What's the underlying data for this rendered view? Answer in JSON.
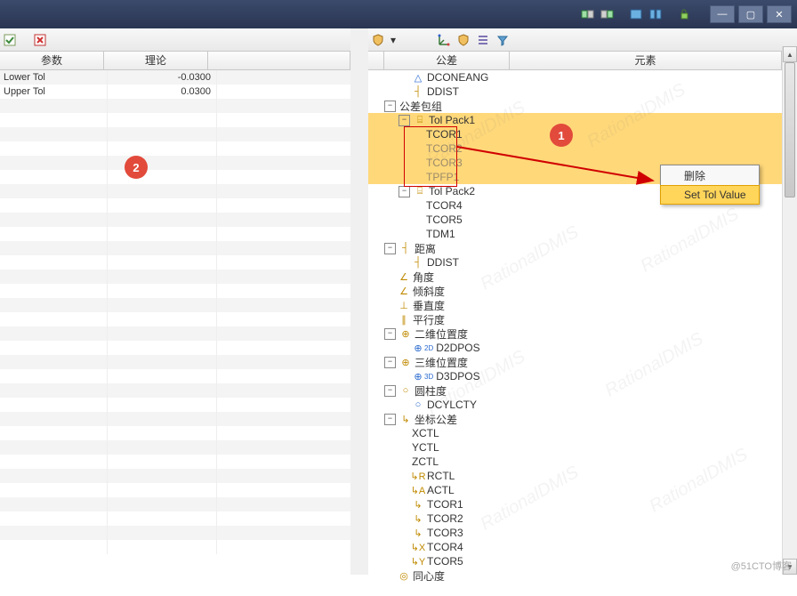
{
  "titlebar": {},
  "left": {
    "headers": {
      "param": "参数",
      "theory": "理论"
    },
    "rows": [
      {
        "param": "Lower Tol",
        "value": "-0.0300",
        "alt": true
      },
      {
        "param": "Upper Tol",
        "value": "0.0300",
        "alt": false
      }
    ],
    "badge": "2"
  },
  "right": {
    "headers": {
      "tol": "公差",
      "elem": "元素"
    },
    "badge": "1",
    "context": {
      "del": "删除",
      "set": "Set Tol Value"
    },
    "tree": [
      {
        "ind": 1,
        "exp": "",
        "icon": "△",
        "iconColor": "#2a6ad0",
        "label": "DCONEANG"
      },
      {
        "ind": 1,
        "exp": "",
        "icon": "┤",
        "iconColor": "#c08a00",
        "label": "DDIST"
      },
      {
        "ind": 0,
        "exp": "-",
        "icon": "",
        "iconColor": "",
        "label": "公差包组"
      },
      {
        "ind": 1,
        "exp": "-",
        "icon": "⌸",
        "iconColor": "#c08a00",
        "label": "Tol Pack1",
        "selrow": true
      },
      {
        "ind": 2,
        "exp": "",
        "icon": "",
        "iconColor": "",
        "label": "TCOR1",
        "sel": true,
        "rb": "top"
      },
      {
        "ind": 2,
        "exp": "",
        "icon": "",
        "iconColor": "",
        "label": "TCOR2",
        "sel": true,
        "gray": true
      },
      {
        "ind": 2,
        "exp": "",
        "icon": "",
        "iconColor": "",
        "label": "TCOR3",
        "sel": true,
        "gray": true
      },
      {
        "ind": 2,
        "exp": "",
        "icon": "",
        "iconColor": "",
        "label": "TPFP1",
        "sel": true,
        "gray": true,
        "rb": "bot"
      },
      {
        "ind": 1,
        "exp": "-",
        "icon": "⌸",
        "iconColor": "#c08a00",
        "label": "Tol Pack2"
      },
      {
        "ind": 2,
        "exp": "",
        "icon": "",
        "iconColor": "",
        "label": "TCOR4"
      },
      {
        "ind": 2,
        "exp": "",
        "icon": "",
        "iconColor": "",
        "label": "TCOR5"
      },
      {
        "ind": 2,
        "exp": "",
        "icon": "",
        "iconColor": "",
        "label": "TDM1"
      },
      {
        "ind": 0,
        "exp": "-",
        "icon": "┤",
        "iconColor": "#c08a00",
        "label": "距离"
      },
      {
        "ind": 1,
        "exp": "",
        "icon": "┤",
        "iconColor": "#c08a00",
        "label": "DDIST"
      },
      {
        "ind": 0,
        "exp": "",
        "icon": "∠",
        "iconColor": "#c08a00",
        "label": "角度"
      },
      {
        "ind": 0,
        "exp": "",
        "icon": "∠",
        "iconColor": "#c08a00",
        "label": "倾斜度"
      },
      {
        "ind": 0,
        "exp": "",
        "icon": "⊥",
        "iconColor": "#c08a00",
        "label": "垂直度"
      },
      {
        "ind": 0,
        "exp": "",
        "icon": "∥",
        "iconColor": "#c08a00",
        "label": "平行度"
      },
      {
        "ind": 0,
        "exp": "-",
        "icon": "⊕",
        "iconColor": "#c08a00",
        "label": "二维位置度"
      },
      {
        "ind": 1,
        "exp": "",
        "icon": "⊕",
        "iconColor": "#2a6ad0",
        "sup": "2D",
        "label": "D2DPOS"
      },
      {
        "ind": 0,
        "exp": "-",
        "icon": "⊕",
        "iconColor": "#c08a00",
        "label": "三维位置度"
      },
      {
        "ind": 1,
        "exp": "",
        "icon": "⊕",
        "iconColor": "#2a6ad0",
        "sup": "3D",
        "label": "D3DPOS"
      },
      {
        "ind": 0,
        "exp": "-",
        "icon": "○",
        "iconColor": "#c08a00",
        "label": "圆柱度"
      },
      {
        "ind": 1,
        "exp": "",
        "icon": "○",
        "iconColor": "#2a6ad0",
        "label": "DCYLCTY"
      },
      {
        "ind": 0,
        "exp": "-",
        "icon": "↳",
        "iconColor": "#c08a00",
        "label": "坐标公差"
      },
      {
        "ind": 1,
        "exp": "",
        "icon": "",
        "iconColor": "",
        "label": "XCTL"
      },
      {
        "ind": 1,
        "exp": "",
        "icon": "",
        "iconColor": "",
        "label": "YCTL"
      },
      {
        "ind": 1,
        "exp": "",
        "icon": "",
        "iconColor": "",
        "label": "ZCTL"
      },
      {
        "ind": 1,
        "exp": "",
        "icon": "↳R",
        "iconColor": "#c08a00",
        "label": "RCTL"
      },
      {
        "ind": 1,
        "exp": "",
        "icon": "↳A",
        "iconColor": "#c08a00",
        "label": "ACTL"
      },
      {
        "ind": 1,
        "exp": "",
        "icon": "↳",
        "iconColor": "#c08a00",
        "label": "TCOR1"
      },
      {
        "ind": 1,
        "exp": "",
        "icon": "↳",
        "iconColor": "#c08a00",
        "label": "TCOR2"
      },
      {
        "ind": 1,
        "exp": "",
        "icon": "↳",
        "iconColor": "#c08a00",
        "label": "TCOR3"
      },
      {
        "ind": 1,
        "exp": "",
        "icon": "↳X",
        "iconColor": "#c08a00",
        "label": "TCOR4"
      },
      {
        "ind": 1,
        "exp": "",
        "icon": "↳Y",
        "iconColor": "#c08a00",
        "label": "TCOR5"
      },
      {
        "ind": 0,
        "exp": "",
        "icon": "◎",
        "iconColor": "#c08a00",
        "label": "同心度"
      }
    ]
  },
  "footer": "@51CTO博客"
}
